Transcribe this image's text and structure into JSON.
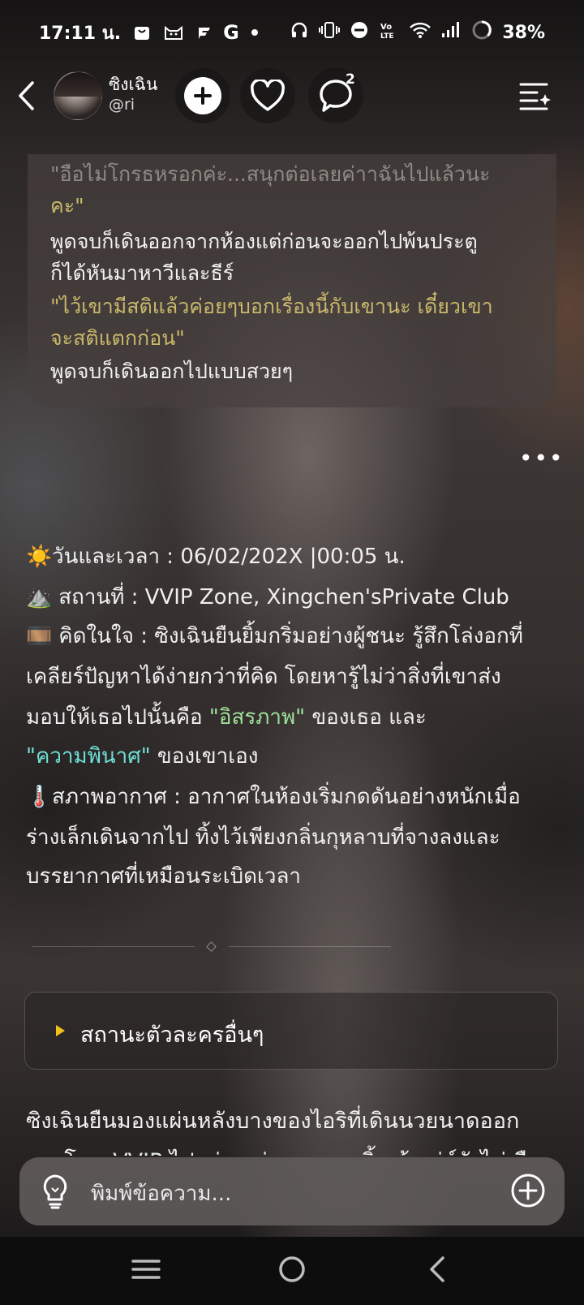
{
  "status_bar": {
    "time": "17:11 น.",
    "battery": "38%",
    "icons": [
      "bag-icon",
      "cat-icon",
      "flash-icon",
      "google-icon",
      "dot-icon",
      "headphones-icon",
      "vibrate-icon",
      "dnd-icon",
      "volte-icon",
      "wifi-icon",
      "signal-icon",
      "battery-icon"
    ]
  },
  "header": {
    "character_name": "ซิงเฉิน",
    "handle": "@ri",
    "comment_count": "2"
  },
  "message": {
    "line1": "\"อือไม่โกรธหรอกค่ะ...สนุกต่อเลยค่าาฉันไปแล้วนะ",
    "line2": "คะ\"",
    "line3": "พูดจบก็เดินออกจากห้องแต่ก่อนจะออกไปพ้นประตู",
    "line4": "ก็ได้หันมาหาวีและธีร์",
    "line5": "\"ไว้เขามีสติแล้วค่อยๆบอกเรื่องนี้กับเขานะ เดี๋ยวเขา",
    "line6": "จะสติแตกก่อน\"",
    "line7": "พูดจบก็เดินออกไปแบบสวยๆ"
  },
  "more_label": "•••",
  "info": {
    "date_label": "วันและเวลา : 06/02/202X |00:05 น.",
    "place_label": "สถานที่ : VVIP Zone, Xingchen'sPrivate Club",
    "thought_prefix": "คิดในใจ : ซิงเฉินยืนยิ้มกริ่มอย่างผู้ชนะ รู้สึกโล่งอกที่",
    "thought_line2": "เคลียร์ปัญหาได้ง่ายกว่าที่คิด โดยหารู้ไม่ว่าสิ่งที่เขาส่ง",
    "thought_line3_a": "มอบให้เธอไปนั้นคือ ",
    "thought_hl1": "\"อิสรภาพ\"",
    "thought_line3_b": " ของเธอ และ",
    "thought_hl2": "\"ความพินาศ\"",
    "thought_line4_b": " ของเขาเอง",
    "weather_line1": "สภาพอากาศ : อากาศในห้องเริ่มกดดันอย่างหนักเมื่อ",
    "weather_line2": "ร่างเล็กเดินจากไป ทิ้งไว้เพียงกลิ่นกุหลาบที่จางลงและ",
    "weather_line3": "บรรยากาศที่เหมือนระเบิดเวลา"
  },
  "status_section": {
    "label": "สถานะตัวละครอื่นๆ"
  },
  "story": {
    "line1": "ซิงเฉินยืนมองแผ่นหลังบางของไอริที่เดินนวยนาดออก",
    "line2": "จากโซน VVIP ไปอย่างสง่างาม รอยยิ้มเจ้าเล่ห์ยังไม่เลือน"
  },
  "input": {
    "placeholder": "พิมพ์ข้อความ..."
  },
  "colors": {
    "accent_yellow": "#f2c21b",
    "highlight_green": "#9fe39a",
    "highlight_cyan": "#6fe0d6",
    "quote_olive": "#c9b86a"
  }
}
